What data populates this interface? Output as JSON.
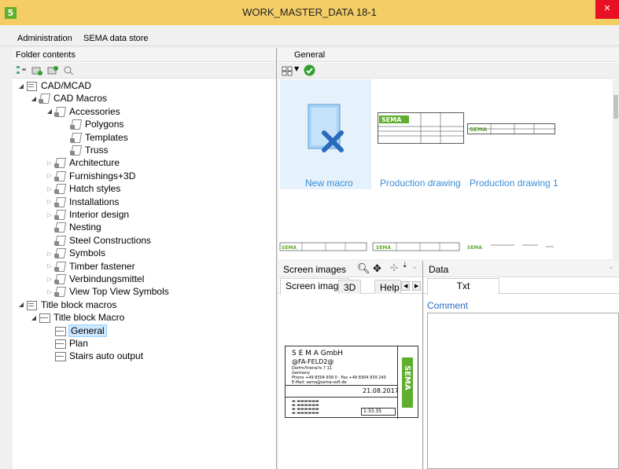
{
  "window": {
    "title": "WORK_MASTER_DATA 18-1",
    "app_icon_letter": "5",
    "close_glyph": "✕"
  },
  "menu": {
    "items": [
      "Administration",
      "SEMA data store"
    ]
  },
  "left_panel": {
    "header": "Folder contents",
    "tree": [
      {
        "label": "CAD/MCAD",
        "level": 0,
        "icon": "folder-icon",
        "expander": "open"
      },
      {
        "label": "CAD Macros",
        "level": 1,
        "icon": "macro-folder-icon",
        "expander": "open"
      },
      {
        "label": "Accessories",
        "level": 2,
        "icon": "macro-folder-icon",
        "expander": "open"
      },
      {
        "label": "Polygons",
        "level": 3,
        "icon": "macro-folder-icon",
        "expander": "none"
      },
      {
        "label": "Templates",
        "level": 3,
        "icon": "macro-folder-icon",
        "expander": "none"
      },
      {
        "label": "Truss",
        "level": 3,
        "icon": "macro-folder-icon",
        "expander": "none"
      },
      {
        "label": "Architecture",
        "level": 2,
        "icon": "macro-folder-icon",
        "expander": "closed"
      },
      {
        "label": "Furnishings+3D",
        "level": 2,
        "icon": "macro-folder-icon",
        "expander": "closed"
      },
      {
        "label": "Hatch styles",
        "level": 2,
        "icon": "macro-folder-icon",
        "expander": "closed"
      },
      {
        "label": "Installations",
        "level": 2,
        "icon": "macro-folder-icon",
        "expander": "closed"
      },
      {
        "label": "Interior design",
        "level": 2,
        "icon": "macro-folder-icon",
        "expander": "closed"
      },
      {
        "label": "Nesting",
        "level": 2,
        "icon": "macro-folder-icon",
        "expander": "none"
      },
      {
        "label": "Steel Constructions",
        "level": 2,
        "icon": "macro-folder-icon",
        "expander": "none"
      },
      {
        "label": "Symbols",
        "level": 2,
        "icon": "macro-folder-icon",
        "expander": "closed"
      },
      {
        "label": "Timber fastener",
        "level": 2,
        "icon": "macro-folder-icon",
        "expander": "closed"
      },
      {
        "label": "Verbindungsmittel",
        "level": 2,
        "icon": "macro-folder-icon",
        "expander": "closed"
      },
      {
        "label": "View Top View Symbols",
        "level": 2,
        "icon": "macro-folder-icon",
        "expander": "closed"
      },
      {
        "label": "Title block macros",
        "level": 0,
        "icon": "folder-icon",
        "expander": "open"
      },
      {
        "label": "Title block Macro",
        "level": 1,
        "icon": "title-block-icon",
        "expander": "open"
      },
      {
        "label": "General",
        "level": 2,
        "icon": "title-block-icon",
        "expander": "none",
        "selected": true
      },
      {
        "label": "Plan",
        "level": 2,
        "icon": "title-block-icon",
        "expander": "none"
      },
      {
        "label": "Stairs auto output",
        "level": 2,
        "icon": "title-block-icon",
        "expander": "none"
      }
    ]
  },
  "right_top": {
    "header": "General",
    "gallery": [
      {
        "label": "New macro"
      },
      {
        "label": "Production drawing"
      },
      {
        "label": "Production drawing 1"
      }
    ]
  },
  "screen_images": {
    "header": "Screen images",
    "tabs": [
      "Screen image",
      "3D",
      "Help"
    ],
    "preview": {
      "company": "S E M A GmbH",
      "field": "@FA-FELD2@",
      "date": "21.08.2017",
      "scale": "1:33.35",
      "lines": [
        "Dorfm?hlstra?e 7 11",
        "Germany",
        "Phone +49 8304 939 0 · Fax +49 8304 939 240",
        "E-Mail: sema@sema-soft.de"
      ]
    }
  },
  "data_panel": {
    "header": "Data",
    "tabs": [
      "Txt"
    ],
    "comment_label": "Comment"
  },
  "colors": {
    "accent": "#3b8fd8",
    "titlebar": "#f4cd66",
    "sema_green": "#5fae2e",
    "close": "#e81123"
  }
}
